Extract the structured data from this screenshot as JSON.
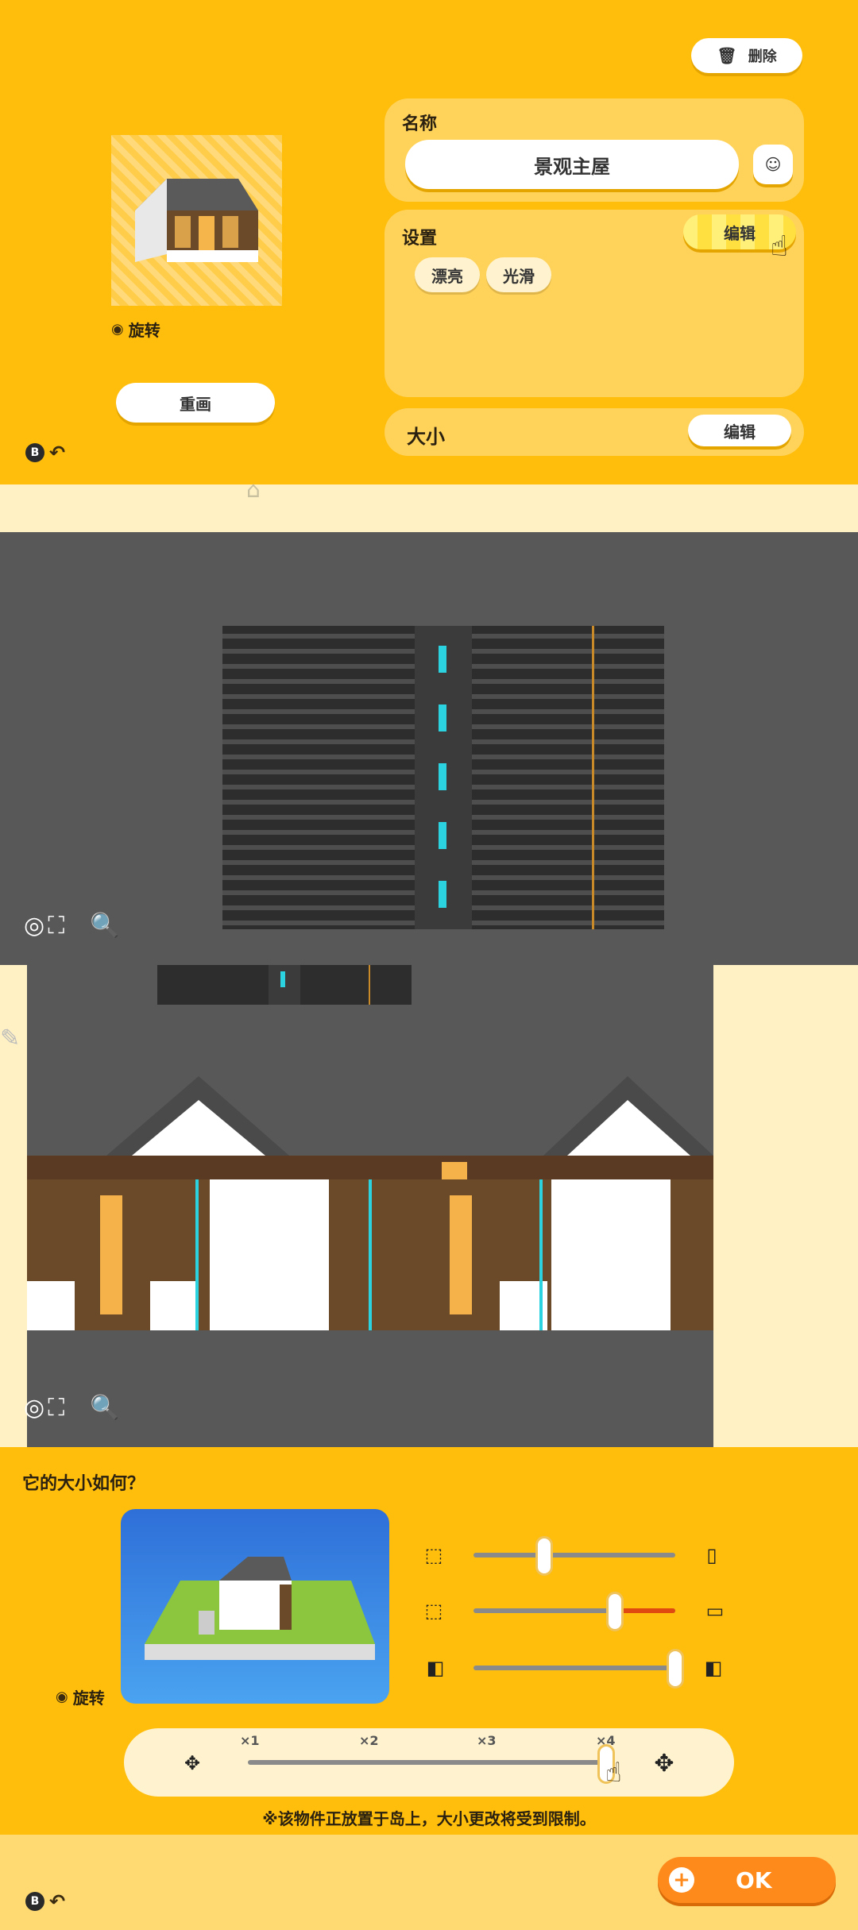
{
  "top": {
    "delete_label": "删除",
    "name_label": "名称",
    "name_value": "景观主屋",
    "settings_label": "设置",
    "edit_label": "编辑",
    "tags": [
      "漂亮",
      "光滑"
    ],
    "size_label": "大小",
    "size_edit_label": "编辑",
    "rotate_label": "旋转",
    "redraw_label": "重画"
  },
  "bottom": {
    "question": "它的大小如何？",
    "rotate_label": "旋转",
    "scale_ticks": [
      "×1",
      "×2",
      "×3",
      "×4"
    ],
    "scale_selected": 4,
    "sliders": [
      {
        "name": "height",
        "value": 0.35
      },
      {
        "name": "width",
        "value": 0.7
      },
      {
        "name": "depth",
        "value": 1.0
      }
    ],
    "notice": "※该物件正放置于岛上，大小更改将受到限制。",
    "ok_label": "OK"
  },
  "colors": {
    "accent": "#ffbd0c",
    "ok_button": "#ff8a1c",
    "canvas": "#585858"
  }
}
